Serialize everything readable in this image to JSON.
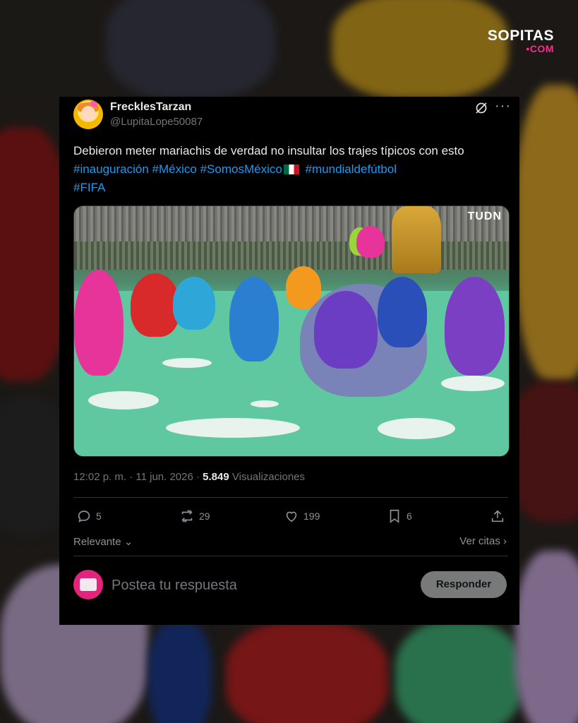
{
  "brand": {
    "name": "SOPITAS",
    "domain": "•COM"
  },
  "tweet": {
    "display_name": "FrecklesTarzan",
    "handle": "@LupitaLope50087",
    "text_plain": "Debieron meter mariachis de verdad no insultar los trajes típicos con esto",
    "hashtags": [
      "#inauguración",
      "#México",
      "#SomosMéxico",
      "#mundialdefútbol",
      "#FIFA"
    ],
    "media_overlay_text": "TUDN",
    "timestamp": "12:02 p. m. · 11 jun. 2026 · ",
    "views_count": "5.849",
    "views_label": " Visualizaciones"
  },
  "actions": {
    "replies": "5",
    "reposts": "29",
    "likes": "199",
    "bookmarks": "6"
  },
  "sort": {
    "label": "Relevante",
    "citations_label": "Ver citas"
  },
  "reply": {
    "placeholder": "Postea tu respuesta",
    "button_label": "Responder"
  },
  "colors": {
    "accent": "#1d9bf0",
    "card_bg": "#000000",
    "brand_accent": "#ff2d8a"
  }
}
